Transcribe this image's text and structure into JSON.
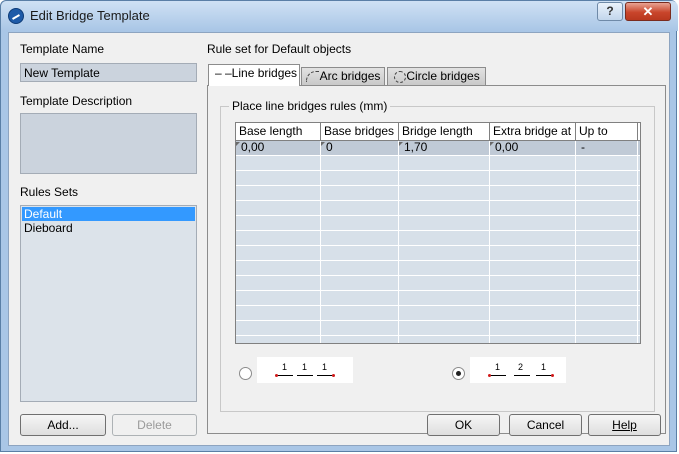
{
  "window": {
    "title": "Edit Bridge Template",
    "help_glyph": "?",
    "close_glyph": "✕"
  },
  "left": {
    "template_name_label": "Template Name",
    "template_name_value": "New Template",
    "template_description_label": "Template Description",
    "template_description_value": "",
    "rules_sets_label": "Rules Sets",
    "rules_sets": [
      "Default",
      "Dieboard"
    ],
    "selected_rule_set": "Default",
    "add_button": "Add...",
    "delete_button": "Delete"
  },
  "right": {
    "ruleset_label": "Rule set for Default objects",
    "tabs": [
      {
        "label": "– –Line bridges",
        "active": true
      },
      {
        "label": "Arc bridges",
        "active": false
      },
      {
        "label": "Circle bridges",
        "active": false
      }
    ],
    "group_title": "Place line bridges rules (mm)",
    "columns": [
      "Base length",
      "Base bridges",
      "Bridge length",
      "Extra bridge at",
      "Up to"
    ],
    "rows": [
      [
        "0,00",
        "0",
        "1,70",
        "0,00",
        "-"
      ]
    ],
    "option_a": {
      "numbers": [
        "1",
        "1",
        "1"
      ],
      "selected": false
    },
    "option_b": {
      "numbers": [
        "1",
        "2",
        "1"
      ],
      "selected": true
    }
  },
  "footer": {
    "ok": "OK",
    "cancel": "Cancel",
    "help": "Help"
  },
  "colors": {
    "selection": "#3399ff",
    "title_bar": "#a9c6e6",
    "close_button": "#c9452b"
  }
}
